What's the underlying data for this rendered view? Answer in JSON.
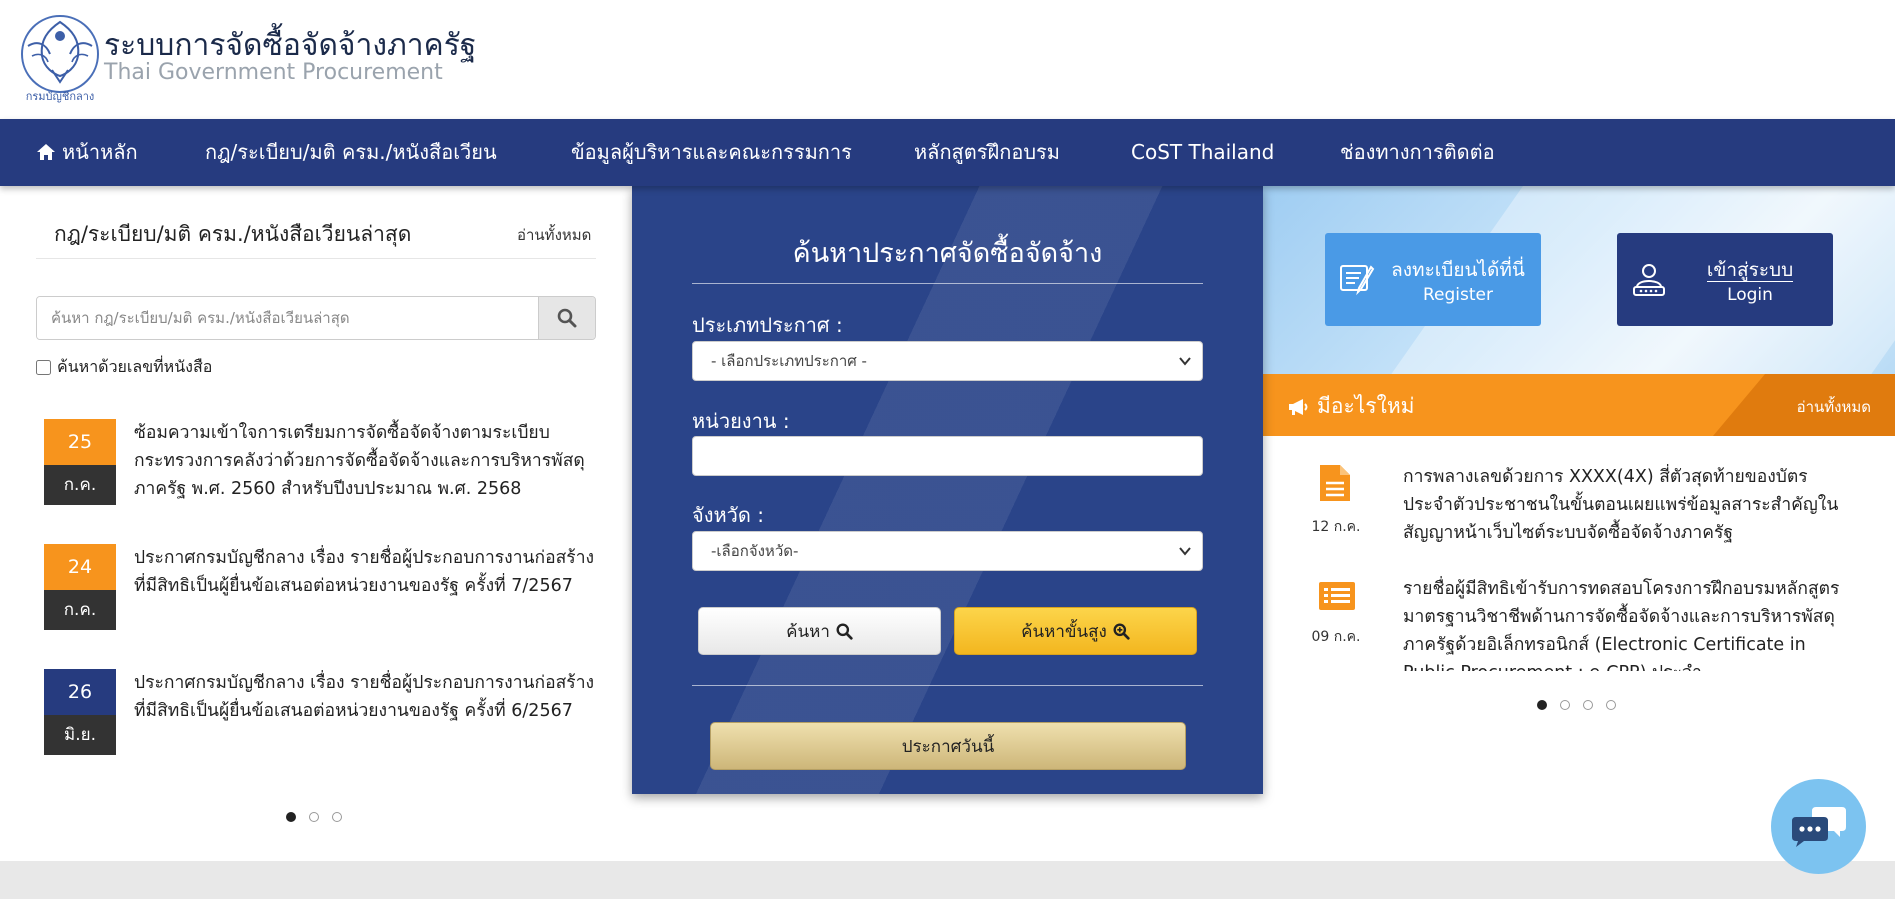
{
  "header": {
    "title_th": "ระบบการจัดซื้อจัดจ้างภาครัฐ",
    "title_en": "Thai Government Procurement",
    "logo_icon": "garuda-seal-icon",
    "logo_text": "กรมบัญชีกลาง"
  },
  "nav": {
    "items": [
      {
        "label": "หน้าหลัก",
        "icon": "home-icon"
      },
      {
        "label": "กฎ/ระเบียบ/มติ ครม./หนังสือเวียน"
      },
      {
        "label": "ข้อมูลผู้บริหารและคณะกรรมการ"
      },
      {
        "label": "หลักสูตรฝึกอบรม"
      },
      {
        "label": "CoST Thailand"
      },
      {
        "label": "ช่องทางการติดต่อ"
      }
    ]
  },
  "laws": {
    "title": "กฎ/ระเบียบ/มติ ครม./หนังสือเวียนล่าสุด",
    "read_all": "อ่านทั้งหมด",
    "search_placeholder": "ค้นหา กฎ/ระเบียบ/มติ ครม./หนังสือเวียนล่าสุด",
    "checkbox_label": "ค้นหาด้วยเลขที่หนังสือ",
    "items": [
      {
        "day": "25",
        "month": "ก.ค.",
        "color": "#f7941d",
        "text": "ซ้อมความเข้าใจการเตรียมการจัดซื้อจัดจ้างตามระเบียบกระทรวงการคลังว่าด้วยการจัดซื้อจัดจ้างและการบริหารพัสดุภาครัฐ พ.ศ. 2560 สำหรับปีงบประมาณ พ.ศ. 2568"
      },
      {
        "day": "24",
        "month": "ก.ค.",
        "color": "#f7941d",
        "text": "ประกาศกรมบัญชีกลาง เรื่อง รายชื่อผู้ประกอบการงานก่อสร้างที่มีสิทธิเป็นผู้ยื่นข้อเสนอต่อหน่วยงานของรัฐ ครั้งที่ 7/2567"
      },
      {
        "day": "26",
        "month": "มิ.ย.",
        "color": "#263b7f",
        "text": "ประกาศกรมบัญชีกลาง เรื่อง รายชื่อผู้ประกอบการงานก่อสร้างที่มีสิทธิเป็นผู้ยื่นข้อเสนอต่อหน่วยงานของรัฐ ครั้งที่ 6/2567"
      }
    ]
  },
  "search_panel": {
    "title": "ค้นหาประกาศจัดซื้อจัดจ้าง",
    "type_label": "ประเภทประกาศ :",
    "type_selected": "- เลือกประเภทประกาศ -",
    "agency_label": "หน่วยงาน :",
    "agency_value": "",
    "province_label": "จังหวัด :",
    "province_selected": "-เลือกจังหวัด-",
    "search_button": "ค้นหา",
    "advanced_button": "ค้นหาขั้นสูง",
    "today_button": "ประกาศวันนี้"
  },
  "account": {
    "register_th": "ลงทะเบียนได้ที่นี่",
    "register_en": "Register",
    "login_th": "เข้าสู่ระบบ",
    "login_en": "Login"
  },
  "whats_new": {
    "title": "มีอะไรใหม่",
    "read_all": "อ่านทั้งหมด",
    "items": [
      {
        "date": "12 ก.ค.",
        "icon": "document-icon",
        "text": "การพลางเลขด้วยการ XXXX(4X) สี่ตัวสุดท้ายของบัตรประจำตัวประชาชนในขั้นตอนเผยแพร่ข้อมูลสาระสำคัญในสัญญาหน้าเว็บไซต์ระบบจัดซื้อจัดจ้างภาครัฐ"
      },
      {
        "date": "09 ก.ค.",
        "icon": "list-icon",
        "text": "รายชื่อผู้มีสิทธิเข้ารับการทดสอบโครงการฝึกอบรมหลักสูตรมาตรฐานวิชาชีพด้านการจัดซื้อจัดจ้างและการบริหารพัสดุภาครัฐด้วยอิเล็กทรอนิกส์ (Electronic Certificate in Public Procurement : e-CPP) ประจำ"
      }
    ]
  },
  "colors": {
    "navy": "#263b7f",
    "orange": "#f7941d",
    "blue": "#4a9ae6",
    "gold": "#f3b61f"
  }
}
